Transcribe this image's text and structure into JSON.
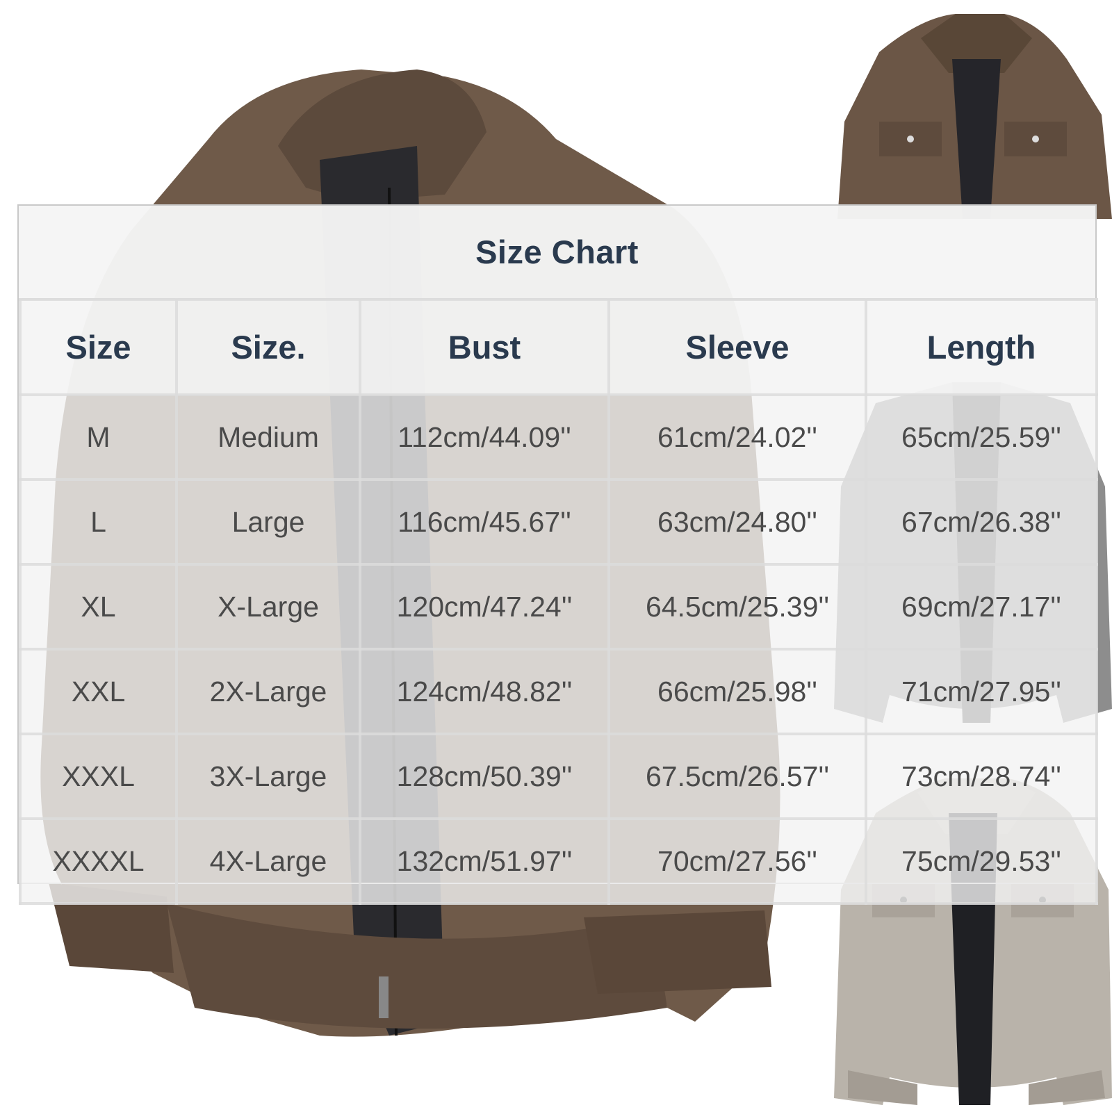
{
  "chart": {
    "title": "Size Chart",
    "headers": [
      "Size",
      "Size.",
      "Bust",
      "Sleeve",
      "Length"
    ],
    "rows": [
      [
        "M",
        "Medium",
        "112cm/44.09''",
        "61cm/24.02''",
        "65cm/25.59''"
      ],
      [
        "L",
        "Large",
        "116cm/45.67''",
        "63cm/24.80''",
        "67cm/26.38''"
      ],
      [
        "XL",
        "X-Large",
        "120cm/47.24''",
        "64.5cm/25.39''",
        "69cm/27.17''"
      ],
      [
        "XXL",
        "2X-Large",
        "124cm/48.82''",
        "66cm/25.98''",
        "71cm/27.95''"
      ],
      [
        "XXXL",
        "3X-Large",
        "128cm/50.39''",
        "67.5cm/26.57''",
        "73cm/28.74''"
      ],
      [
        "XXXXL",
        "4X-Large",
        "132cm/51.97''",
        "70cm/27.56''",
        "75cm/29.53''"
      ]
    ]
  },
  "colors": {
    "header_text": "#2a3a4e",
    "cell_text": "#4a4a4a",
    "jacket_brown": "#6b5646",
    "jacket_grey": "#b9b3aa"
  },
  "images": [
    {
      "icon": "brown-suede-jacket-main"
    },
    {
      "icon": "brown-suede-jacket-thumbnail"
    },
    {
      "icon": "grey-suede-jacket-thumbnail"
    },
    {
      "icon": "light-grey-suede-jacket-thumbnail"
    }
  ]
}
